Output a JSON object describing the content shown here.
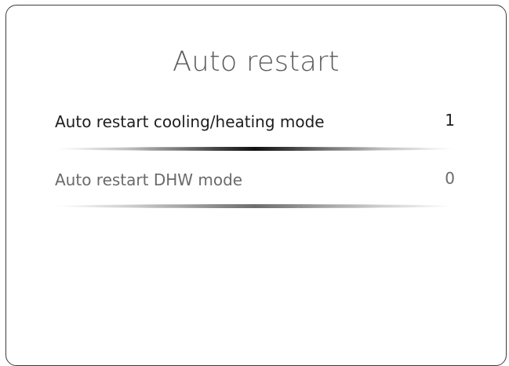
{
  "screen": {
    "title": "Auto restart"
  },
  "settings": [
    {
      "label": "Auto restart cooling/heating mode",
      "value": "1",
      "selected": true
    },
    {
      "label": "Auto restart DHW mode",
      "value": "0",
      "selected": false
    }
  ],
  "colors": {
    "border": "#3c3c3c",
    "title": "#5a5a5a",
    "selected_text": "#1e1e1e",
    "unselected_text": "#6a6a6a"
  }
}
